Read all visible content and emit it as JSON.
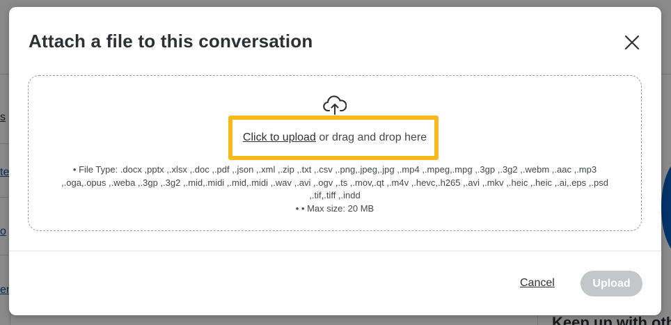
{
  "background": {
    "links": [
      "s",
      "te",
      "o",
      "en"
    ],
    "right_heading": "Keep up with oth"
  },
  "modal": {
    "title": "Attach a file to this conversation",
    "close_icon": "close-icon",
    "dropzone": {
      "icon": "cloud-upload-icon",
      "upload_link_label": "Click to upload",
      "drag_text": "or drag and drop here",
      "file_type_lines": [
        "• File Type: .docx ,pptx ,.xlsx ,.doc ,.pdf ,.json ,.xml ,.zip ,.txt ,.csv ,.png,.jpeg,.jpg ,.mp4 ,.mpeg,.mpg ,.3gp ,.3g2 ,.webm ,.aac ,.mp3",
        ",.oga,.opus ,.weba ,.3gp ,.3g2 ,.mid,.midi ,.mid,.midi ,.wav ,.avi ,.ogv ,.ts ,.mov,.qt ,.m4v ,.hevc,.h265 ,.avi ,.mkv ,.heic ,.heic ,.ai,.eps ,.psd",
        ",.tif,.tiff ,.indd"
      ],
      "max_size": "• • Max size: 20 MB"
    },
    "footer": {
      "cancel_label": "Cancel",
      "upload_label": "Upload"
    }
  },
  "colors": {
    "highlight": "#f8b91c",
    "text": "#2e2f32",
    "disabled_button": "#c4c6c8"
  }
}
